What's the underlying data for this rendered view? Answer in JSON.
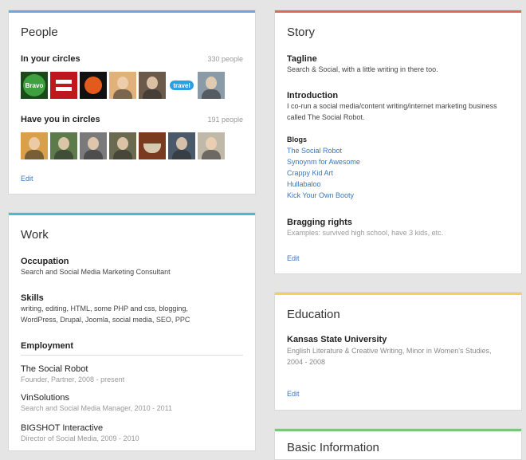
{
  "colors": {
    "people_bar": "#6da6e8",
    "story_bar": "#dd6b5b",
    "work_bar": "#48b9d6",
    "education_bar": "#f4cf5a",
    "places_bar": "#7bc67e",
    "link": "#3b76c0"
  },
  "people": {
    "title": "People",
    "in_circles_label": "In your circles",
    "in_circles_count": "330 people",
    "have_you_label": "Have you in circles",
    "have_you_count": "191 people",
    "edit": "Edit",
    "in_circles_avatars": [
      {
        "icon": "bravo-logo-avatar",
        "text": "Bravo",
        "bg": "#1a4a1a"
      },
      {
        "icon": "equal-sign-avatar",
        "text": "",
        "bg": "#c0171d"
      },
      {
        "icon": "circle-logo-avatar",
        "text": "",
        "bg": "#111111"
      },
      {
        "icon": "woman-portrait-avatar",
        "text": "",
        "bg": "#e2b07a"
      },
      {
        "icon": "man-portrait-avatar",
        "text": "",
        "bg": "#6b5a4a"
      },
      {
        "icon": "travel-logo-avatar",
        "text": "travel",
        "bg": "#ffffff"
      },
      {
        "icon": "man-glasses-avatar",
        "text": "",
        "bg": "#8a9aa6"
      }
    ],
    "have_you_avatars": [
      {
        "icon": "popart-portrait-avatar",
        "text": "",
        "bg": "#d8a04a"
      },
      {
        "icon": "man-portrait-avatar",
        "text": "",
        "bg": "#5d7a4a"
      },
      {
        "icon": "man-smiling-avatar",
        "text": "",
        "bg": "#7a7a7a"
      },
      {
        "icon": "man-outdoor-avatar",
        "text": "",
        "bg": "#6a6a50"
      },
      {
        "icon": "coffee-cup-avatar",
        "text": "",
        "bg": "#7a3a20"
      },
      {
        "icon": "man-standing-avatar",
        "text": "",
        "bg": "#4a5a6a"
      },
      {
        "icon": "man-glasses-avatar",
        "text": "",
        "bg": "#c0b8a8"
      }
    ]
  },
  "work": {
    "title": "Work",
    "occupation_label": "Occupation",
    "occupation_value": "Search and Social Media Marketing Consultant",
    "skills_label": "Skills",
    "skills_value": "writing, editing, HTML, some PHP and css, blogging, WordPress, Drupal, Joomla, social media, SEO, PPC",
    "employment_label": "Employment",
    "jobs": [
      {
        "company": "The Social Robot",
        "role": "Founder, Partner, 2008 - present"
      },
      {
        "company": "VinSolutions",
        "role": "Search and Social Media Manager, 2010 - 2011"
      },
      {
        "company": "BIGSHOT Interactive",
        "role": "Director of Social Media, 2009 - 2010"
      }
    ]
  },
  "story": {
    "title": "Story",
    "tagline_label": "Tagline",
    "tagline_value": "Search & Social, with a little writing in there too.",
    "intro_label": "Introduction",
    "intro_value": "I co-run a social media/content writing/internet marketing business called The Social Robot.",
    "blogs_label": "Blogs",
    "blogs": [
      "The Social Robot",
      "Synoynm for Awesome",
      "Crappy Kid Art",
      "Hullabaloo",
      "Kick Your Own Booty"
    ],
    "bragging_label": "Bragging rights",
    "bragging_placeholder": "Examples: survived high school, have 3 kids, etc.",
    "edit": "Edit"
  },
  "education": {
    "title": "Education",
    "school": "Kansas State University",
    "details": "English Literature & Creative Writing, Minor in Women's Studies, 2004 - 2008",
    "edit": "Edit"
  },
  "places": {
    "title": "Basic Information"
  }
}
